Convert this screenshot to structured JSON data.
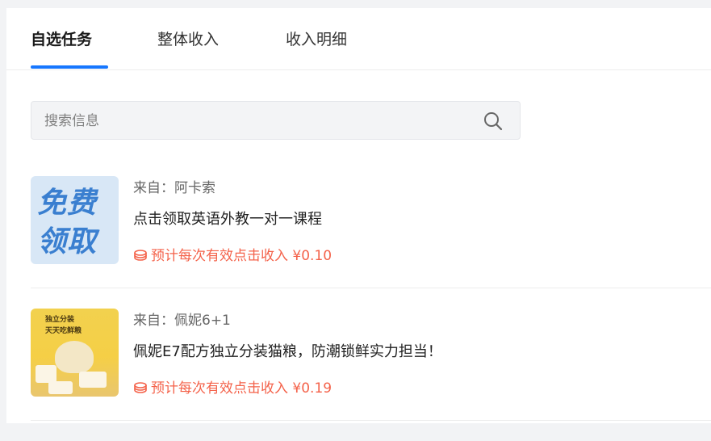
{
  "tabs": [
    {
      "label": "自选任务",
      "active": true
    },
    {
      "label": "整体收入",
      "active": false
    },
    {
      "label": "收入明细",
      "active": false
    }
  ],
  "search": {
    "placeholder": "搜索信息",
    "value": "",
    "icon": "search-icon"
  },
  "tasks": [
    {
      "thumb_text_line1": "免费",
      "thumb_text_line2": "领取",
      "source": "来自：阿卡索",
      "title": "点击领取英语外教一对一课程",
      "income": "预计每次有效点击收入 ¥0.10"
    },
    {
      "thumb_text_line1": "独立分装",
      "thumb_text_line2": "天天吃鲜粮",
      "source": "来自：佩妮6+1",
      "title": "佩妮E7配方独立分装猫粮，防潮锁鲜实力担当！",
      "income": "预计每次有效点击收入 ¥0.19"
    }
  ],
  "colors": {
    "accent": "#1677ff",
    "income": "#f4624a"
  }
}
